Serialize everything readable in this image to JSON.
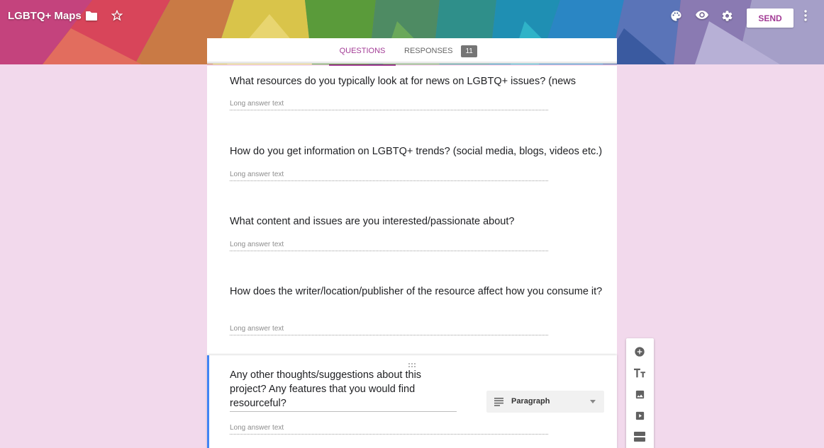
{
  "header": {
    "title": "LGBTQ+ Maps",
    "send_label": "SEND",
    "icons": [
      "folder-icon",
      "star-icon",
      "palette-icon",
      "eye-icon",
      "gear-icon",
      "more-vert-icon"
    ]
  },
  "tabs": {
    "questions_label": "QUESTIONS",
    "responses_label": "RESPONSES",
    "responses_count": "11"
  },
  "questions": [
    {
      "title": "What resources do you typically look at for news on LGBTQ+ issues? (news",
      "answer_placeholder": "Long answer text"
    },
    {
      "title": "How do you get information on LGBTQ+ trends? (social media, blogs, videos etc.)",
      "answer_placeholder": "Long answer text"
    },
    {
      "title": "What content and issues are you interested/passionate about?",
      "answer_placeholder": "Long answer text"
    },
    {
      "title": "How does the writer/location/publisher of the resource affect how you consume it?",
      "answer_placeholder": "Long answer text"
    }
  ],
  "active_question": {
    "title": "Any other thoughts/suggestions about this project? Any features that you would find resourceful?",
    "type": "Paragraph",
    "answer_placeholder": "Long answer text"
  },
  "toolbar": {
    "items": [
      "add-question-icon",
      "add-title-icon",
      "add-image-icon",
      "add-video-icon",
      "add-section-icon"
    ]
  },
  "colors": {
    "accent": "#a33c96",
    "background": "#f2d9ec",
    "active_border": "#4285f4"
  }
}
